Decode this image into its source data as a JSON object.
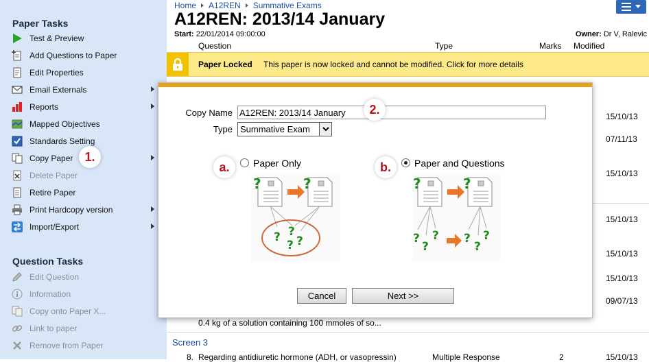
{
  "sidebar": {
    "paper_tasks_title": "Paper Tasks",
    "paper_tasks": [
      {
        "label": "Test & Preview",
        "icon": "play-icon",
        "disabled": false,
        "submenu": false
      },
      {
        "label": "Add Questions to Paper",
        "icon": "add-document-icon",
        "disabled": false,
        "submenu": false
      },
      {
        "label": "Edit Properties",
        "icon": "edit-document-icon",
        "disabled": false,
        "submenu": false
      },
      {
        "label": "Email Externals",
        "icon": "envelope-icon",
        "disabled": false,
        "submenu": true
      },
      {
        "label": "Reports",
        "icon": "bar-chart-icon",
        "disabled": false,
        "submenu": true
      },
      {
        "label": "Mapped Objectives",
        "icon": "map-icon",
        "disabled": false,
        "submenu": false
      },
      {
        "label": "Standards Setting",
        "icon": "checkbox-icon",
        "disabled": false,
        "submenu": false
      },
      {
        "label": "Copy Paper",
        "icon": "copy-icon",
        "disabled": false,
        "submenu": true
      },
      {
        "label": "Delete Paper",
        "icon": "delete-document-icon",
        "disabled": true,
        "submenu": false
      },
      {
        "label": "Retire Paper",
        "icon": "retire-document-icon",
        "disabled": false,
        "submenu": false
      },
      {
        "label": "Print Hardcopy version",
        "icon": "printer-icon",
        "disabled": false,
        "submenu": true
      },
      {
        "label": "Import/Export",
        "icon": "import-export-icon",
        "disabled": false,
        "submenu": true
      }
    ],
    "question_tasks_title": "Question Tasks",
    "question_tasks": [
      {
        "label": "Edit Question",
        "icon": "pencil-icon",
        "disabled": true
      },
      {
        "label": "Information",
        "icon": "info-icon",
        "disabled": true
      },
      {
        "label": "Copy onto Paper X...",
        "icon": "copy-icon",
        "disabled": true
      },
      {
        "label": "Link to paper",
        "icon": "link-icon",
        "disabled": true
      },
      {
        "label": "Remove from Paper",
        "icon": "remove-icon",
        "disabled": true
      }
    ]
  },
  "header": {
    "breadcrumb": [
      "Home",
      "A12REN",
      "Summative Exams"
    ],
    "title": "A12REN: 2013/14 January",
    "start_label": "Start:",
    "start_value": "22/01/2014 09:00:00",
    "owner_label": "Owner:",
    "owner_value": "Dr V, Ralevic",
    "columns": [
      "Question",
      "Type",
      "Marks",
      "Modified"
    ]
  },
  "lock_bar": {
    "title": "Paper Locked",
    "message": "This paper is now locked and cannot be modified. Click for more details"
  },
  "background_rows": {
    "dates": [
      "15/10/13",
      "07/11/13",
      "15/10/13",
      "15/10/13",
      "15/10/13",
      "15/10/13",
      "09/07/13"
    ],
    "fragment_text": "0.4 kg of a solution containing 100 mmoles of so...",
    "screen_label": "Screen 3",
    "last_row": {
      "num": "8.",
      "question": "Regarding antidiuretic hormone (ADH, or vasopressin)",
      "type": "Multiple Response",
      "marks": "2",
      "modified": "15/10/13"
    }
  },
  "dialog": {
    "copy_name_label": "Copy Name",
    "copy_name_value": "A12REN: 2013/14 January",
    "type_label": "Type",
    "type_value": "Summative Exam",
    "option_a_label": "Paper Only",
    "option_b_label": "Paper and Questions",
    "option_selected": "b",
    "cancel_label": "Cancel",
    "next_label": "Next >>"
  },
  "callouts": {
    "one": "1.",
    "two": "2.",
    "a": "a.",
    "b": "b."
  },
  "colors": {
    "sidebar_bg": "#d9e6f8",
    "accent_orange": "#e7a21a",
    "lock_yellow": "#fde98a",
    "link_blue": "#1b4fa5",
    "callout_red": "#b5141c",
    "question_green": "#1f8a1f"
  }
}
